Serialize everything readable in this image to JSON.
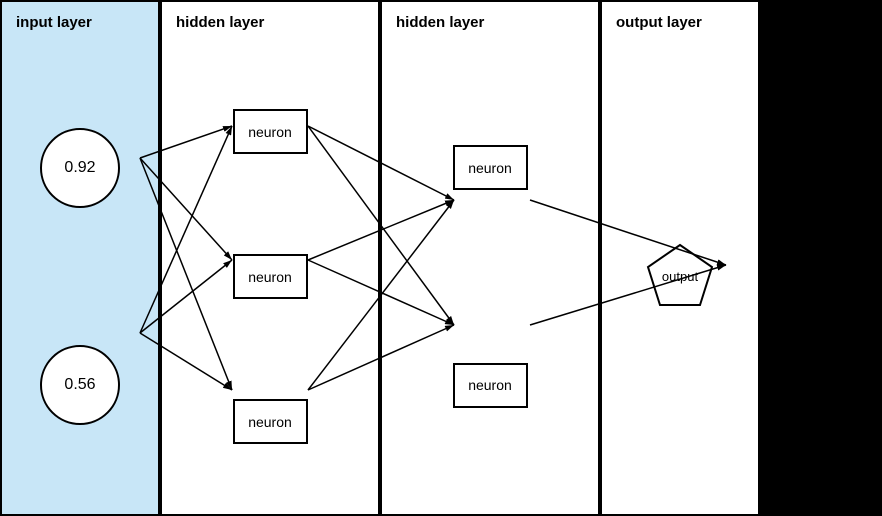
{
  "diagram": {
    "layers": [
      {
        "id": "input-layer",
        "title": "input layer",
        "type": "input",
        "nodes": [
          {
            "label": "0.92"
          },
          {
            "label": "0.56"
          }
        ]
      },
      {
        "id": "hidden-layer-1",
        "title": "hidden layer",
        "type": "hidden",
        "nodes": [
          {
            "label": "neuron"
          },
          {
            "label": "neuron"
          },
          {
            "label": "neuron"
          }
        ]
      },
      {
        "id": "hidden-layer-2",
        "title": "hidden layer",
        "type": "hidden",
        "nodes": [
          {
            "label": "neuron"
          },
          {
            "label": "neuron"
          }
        ]
      },
      {
        "id": "output-layer",
        "title": "output layer",
        "type": "output",
        "nodes": [
          {
            "label": "output"
          }
        ]
      }
    ]
  }
}
